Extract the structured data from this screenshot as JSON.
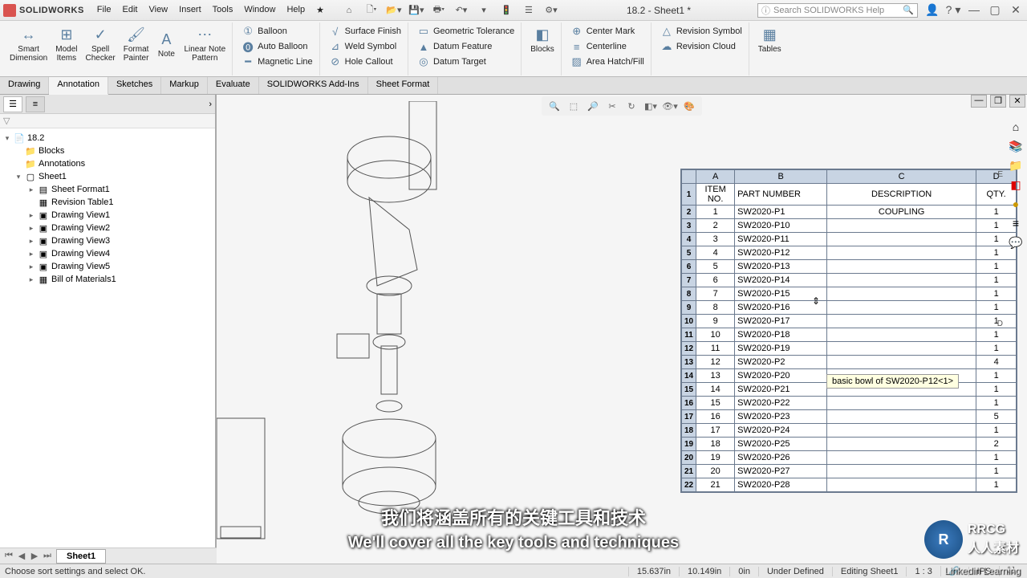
{
  "app": {
    "brand": "SOLIDWORKS",
    "doc_title": "18.2 - Sheet1 *",
    "search_placeholder": "Search SOLIDWORKS Help"
  },
  "menu": [
    "File",
    "Edit",
    "View",
    "Insert",
    "Tools",
    "Window",
    "Help"
  ],
  "ribbon_tabs": [
    "Drawing",
    "Annotation",
    "Sketches",
    "Markup",
    "Evaluate",
    "SOLIDWORKS Add-Ins",
    "Sheet Format"
  ],
  "ribbon": {
    "group1": [
      {
        "label": "Smart\nDimension"
      },
      {
        "label": "Model\nItems"
      },
      {
        "label": "Spell\nChecker"
      },
      {
        "label": "Format\nPainter"
      },
      {
        "label": "Note"
      },
      {
        "label": "Linear Note\nPattern"
      }
    ],
    "col_balloon": [
      "Balloon",
      "Auto Balloon",
      "Magnetic Line"
    ],
    "col_surface": [
      "Surface Finish",
      "Weld Symbol",
      "Hole Callout"
    ],
    "col_gtol": [
      "Geometric Tolerance",
      "Datum Feature",
      "Datum Target"
    ],
    "blocks_label": "Blocks",
    "col_center": [
      "Center Mark",
      "Centerline",
      "Area Hatch/Fill"
    ],
    "col_rev": [
      "Revision Symbol",
      "Revision Cloud"
    ],
    "tables_label": "Tables"
  },
  "tree": {
    "root": "18.2",
    "items": [
      "Blocks",
      "Annotations",
      "Sheet1"
    ],
    "sheet_children": [
      "Sheet Format1",
      "Revision Table1",
      "Drawing View1",
      "Drawing View2",
      "Drawing View3",
      "Drawing View4",
      "Drawing View5",
      "Bill of Materials1"
    ]
  },
  "bom": {
    "col_letters": [
      "A",
      "B",
      "C",
      "D"
    ],
    "headers": [
      "ITEM NO.",
      "PART NUMBER",
      "DESCRIPTION",
      "QTY."
    ],
    "rows": [
      {
        "n": 1,
        "item": "1",
        "part": "SW2020-P1",
        "desc": "COUPLING",
        "qty": "1"
      },
      {
        "n": 2,
        "item": "2",
        "part": "SW2020-P10",
        "desc": "",
        "qty": "1"
      },
      {
        "n": 3,
        "item": "3",
        "part": "SW2020-P11",
        "desc": "",
        "qty": "1"
      },
      {
        "n": 4,
        "item": "4",
        "part": "SW2020-P12",
        "desc": "",
        "qty": "1"
      },
      {
        "n": 5,
        "item": "5",
        "part": "SW2020-P13",
        "desc": "",
        "qty": "1"
      },
      {
        "n": 6,
        "item": "6",
        "part": "SW2020-P14",
        "desc": "",
        "qty": "1"
      },
      {
        "n": 7,
        "item": "7",
        "part": "SW2020-P15",
        "desc": "",
        "qty": "1"
      },
      {
        "n": 8,
        "item": "8",
        "part": "SW2020-P16",
        "desc": "",
        "qty": "1"
      },
      {
        "n": 9,
        "item": "9",
        "part": "SW2020-P17",
        "desc": "",
        "qty": "1"
      },
      {
        "n": 10,
        "item": "10",
        "part": "SW2020-P18",
        "desc": "",
        "qty": "1"
      },
      {
        "n": 11,
        "item": "11",
        "part": "SW2020-P19",
        "desc": "",
        "qty": "1"
      },
      {
        "n": 12,
        "item": "12",
        "part": "SW2020-P2",
        "desc": "",
        "qty": "4"
      },
      {
        "n": 13,
        "item": "13",
        "part": "SW2020-P20",
        "desc": "",
        "qty": "1"
      },
      {
        "n": 14,
        "item": "14",
        "part": "SW2020-P21",
        "desc": "",
        "qty": "1"
      },
      {
        "n": 15,
        "item": "15",
        "part": "SW2020-P22",
        "desc": "",
        "qty": "1"
      },
      {
        "n": 16,
        "item": "16",
        "part": "SW2020-P23",
        "desc": "",
        "qty": "5"
      },
      {
        "n": 17,
        "item": "17",
        "part": "SW2020-P24",
        "desc": "",
        "qty": "1"
      },
      {
        "n": 18,
        "item": "18",
        "part": "SW2020-P25",
        "desc": "",
        "qty": "2"
      },
      {
        "n": 19,
        "item": "19",
        "part": "SW2020-P26",
        "desc": "",
        "qty": "1"
      },
      {
        "n": 20,
        "item": "20",
        "part": "SW2020-P27",
        "desc": "",
        "qty": "1"
      },
      {
        "n": 21,
        "item": "21",
        "part": "SW2020-P28",
        "desc": "",
        "qty": "1"
      }
    ]
  },
  "tooltip": "basic bowl of SW2020-P12<1>",
  "sheet_tab": "Sheet1",
  "status": {
    "left": "Choose sort settings and select OK.",
    "x": "15.637in",
    "y": "10.149in",
    "z": "0in",
    "state": "Under Defined",
    "mode": "Editing Sheet1",
    "scale": "1 : 3",
    "units": "IPS"
  },
  "subtitle_ch": "我们将涵盖所有的关键工具和技术",
  "subtitle_en": "We'll cover all the key tools and techniques",
  "watermark": {
    "badge": "R",
    "text": "RRCG\n人人素材"
  },
  "attribution": "Linkedin Learning",
  "triad": {
    "e": "E",
    "d": "D"
  }
}
